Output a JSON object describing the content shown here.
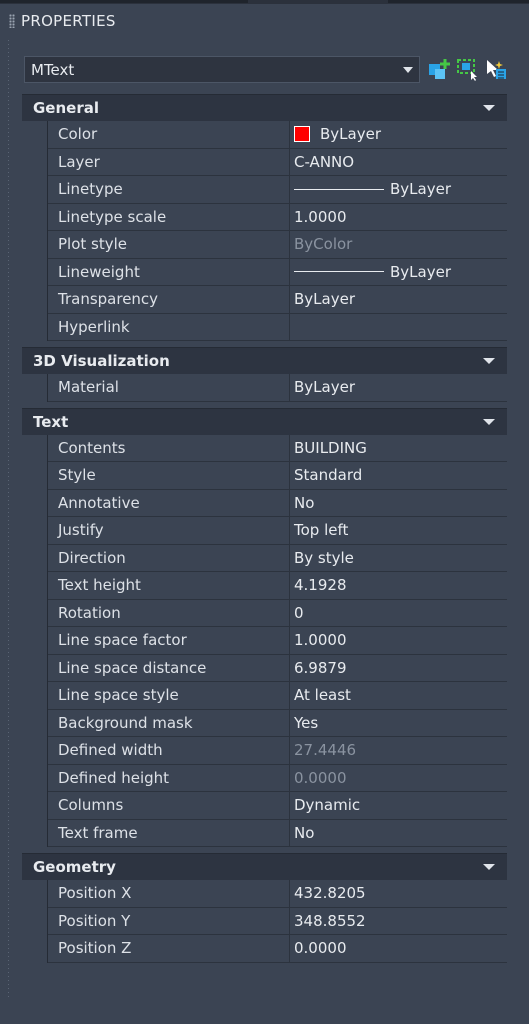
{
  "palette": {
    "title": "PROPERTIES"
  },
  "object_selector": {
    "value": "MText"
  },
  "toolbar": {
    "icons": [
      "add-selection-icon",
      "quick-select-icon",
      "select-objects-icon"
    ]
  },
  "sections": {
    "general": {
      "title": "General",
      "color": {
        "label": "Color",
        "value": "ByLayer",
        "swatch": "#ff0000"
      },
      "layer": {
        "label": "Layer",
        "value": "C-ANNO"
      },
      "linetype": {
        "label": "Linetype",
        "value": "ByLayer"
      },
      "linetype_scale": {
        "label": "Linetype scale",
        "value": "1.0000"
      },
      "plot_style": {
        "label": "Plot style",
        "value": "ByColor"
      },
      "lineweight": {
        "label": "Lineweight",
        "value": "ByLayer"
      },
      "transparency": {
        "label": "Transparency",
        "value": "ByLayer"
      },
      "hyperlink": {
        "label": "Hyperlink",
        "value": ""
      }
    },
    "visualization": {
      "title": "3D Visualization",
      "material": {
        "label": "Material",
        "value": "ByLayer"
      }
    },
    "text": {
      "title": "Text",
      "rows": [
        {
          "label": "Contents",
          "value": "BUILDING"
        },
        {
          "label": "Style",
          "value": "Standard"
        },
        {
          "label": "Annotative",
          "value": "No"
        },
        {
          "label": "Justify",
          "value": "Top left"
        },
        {
          "label": "Direction",
          "value": "By style"
        },
        {
          "label": "Text height",
          "value": "4.1928"
        },
        {
          "label": "Rotation",
          "value": "0"
        },
        {
          "label": "Line space factor",
          "value": "1.0000"
        },
        {
          "label": "Line space distance",
          "value": "6.9879"
        },
        {
          "label": "Line space style",
          "value": "At least"
        },
        {
          "label": "Background mask",
          "value": "Yes"
        },
        {
          "label": "Defined width",
          "value": "27.4446"
        },
        {
          "label": "Defined height",
          "value": "0.0000"
        },
        {
          "label": "Columns",
          "value": "Dynamic"
        },
        {
          "label": "Text frame",
          "value": "No"
        }
      ]
    },
    "geometry": {
      "title": "Geometry",
      "rows": [
        {
          "label": "Position X",
          "value": "432.8205"
        },
        {
          "label": "Position Y",
          "value": "348.8552"
        },
        {
          "label": "Position Z",
          "value": "0.0000"
        }
      ]
    }
  }
}
